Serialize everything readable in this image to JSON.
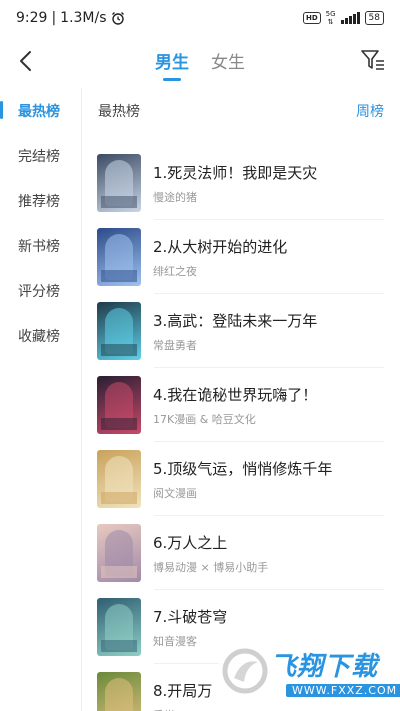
{
  "status_bar": {
    "time": "9:29",
    "network_speed": "1.3M/s",
    "hd_label": "HD",
    "network_type": "5G",
    "battery": "58"
  },
  "header": {
    "tabs": [
      {
        "label": "男生",
        "active": true
      },
      {
        "label": "女生",
        "active": false
      }
    ],
    "icons": {
      "back": "back-arrow-icon",
      "filter": "filter-icon"
    }
  },
  "sidebar": {
    "items": [
      {
        "label": "最热榜",
        "active": true
      },
      {
        "label": "完结榜",
        "active": false
      },
      {
        "label": "推荐榜",
        "active": false
      },
      {
        "label": "新书榜",
        "active": false
      },
      {
        "label": "评分榜",
        "active": false
      },
      {
        "label": "收藏榜",
        "active": false
      }
    ]
  },
  "main": {
    "title": "最热榜",
    "period": "周榜",
    "books": [
      {
        "title": "1.死灵法师！我即是天灾",
        "author": "慢途的猪",
        "cover_colors": [
          "#3b4b63",
          "#c9d6e6"
        ]
      },
      {
        "title": "2.从大树开始的进化",
        "author": "绯红之夜",
        "cover_colors": [
          "#2c4a8a",
          "#9fc3ef"
        ]
      },
      {
        "title": "3.高武：登陆未来一万年",
        "author": "常盘勇者",
        "cover_colors": [
          "#1f3b4a",
          "#5fd0e8"
        ]
      },
      {
        "title": "4.我在诡秘世界玩嗨了！",
        "author": "17K漫画 & 哈豆文化",
        "cover_colors": [
          "#2a1f33",
          "#c94a6a"
        ]
      },
      {
        "title": "5.顶级气运，悄悄修炼千年",
        "author": "阅文漫画",
        "cover_colors": [
          "#c9a25a",
          "#f1e3bf"
        ]
      },
      {
        "title": "6.万人之上",
        "author": "博易动漫 × 博易小助手",
        "cover_colors": [
          "#e8c9c0",
          "#9f8aa8"
        ]
      },
      {
        "title": "7.斗破苍穹",
        "author": "知音漫客",
        "cover_colors": [
          "#2f5e72",
          "#8fd0c6"
        ]
      },
      {
        "title": "8.开局万",
        "author": "秃半",
        "cover_colors": [
          "#6a8a3a",
          "#e0c080"
        ]
      }
    ]
  },
  "watermark": {
    "text": "飞翔下载",
    "url": "WWW.FXXZ.COM"
  },
  "colors": {
    "accent": "#2a94e0",
    "text_primary": "#222222",
    "text_secondary": "#999999"
  }
}
